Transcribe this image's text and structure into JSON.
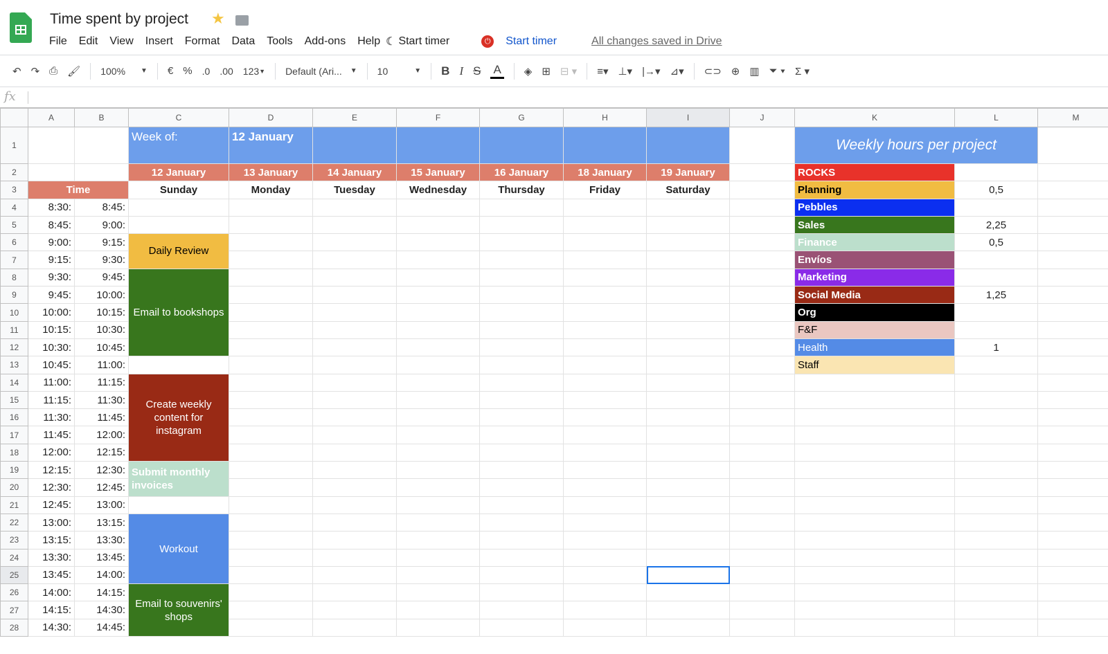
{
  "header": {
    "title": "Time spent by project",
    "menu": [
      "File",
      "Edit",
      "View",
      "Insert",
      "Format",
      "Data",
      "Tools",
      "Add-ons",
      "Help"
    ],
    "start_timer_1": "Start timer",
    "start_timer_2": "Start timer",
    "saved_status": "All changes saved in Drive"
  },
  "toolbar": {
    "zoom": "100%",
    "currency": "€",
    "percent": "%",
    "dec_less": ".0",
    "dec_more": ".00",
    "format_more": "123",
    "font": "Default (Ari...",
    "font_size": "10",
    "bold": "B",
    "italic": "I",
    "strike": "S",
    "text_color": "A",
    "fx": "fx"
  },
  "columns": [
    "A",
    "B",
    "C",
    "D",
    "E",
    "F",
    "G",
    "H",
    "I",
    "J",
    "K",
    "L",
    "M"
  ],
  "sheet": {
    "week_of_label": "Week of:",
    "week_of_value": "12 January",
    "time_label": "Time",
    "dates": [
      "12 January",
      "13 January",
      "14 January",
      "15 January",
      "16 January",
      "18 January",
      "19 January"
    ],
    "days": [
      "Sunday",
      "Monday",
      "Tuesday",
      "Wednesday",
      "Thursday",
      "Friday",
      "Saturday"
    ],
    "time_start": [
      "8:30:",
      "8:45:",
      "9:00:",
      "9:15:",
      "9:30:",
      "9:45:",
      "10:00:",
      "10:15:",
      "10:30:",
      "10:45:",
      "11:00:",
      "11:15:",
      "11:30:",
      "11:45:",
      "12:00:",
      "12:15:",
      "12:30:",
      "12:45:",
      "13:00:",
      "13:15:",
      "13:30:",
      "13:45:",
      "14:00:",
      "14:15:",
      "14:30:"
    ],
    "time_end": [
      "8:45:",
      "9:00:",
      "9:15:",
      "9:30:",
      "9:45:",
      "10:00:",
      "10:15:",
      "10:30:",
      "10:45:",
      "11:00:",
      "11:15:",
      "11:30:",
      "11:45:",
      "12:00:",
      "12:15:",
      "12:30:",
      "12:45:",
      "13:00:",
      "13:15:",
      "13:30:",
      "13:45:",
      "14:00:",
      "14:15:",
      "14:30:",
      "14:45:"
    ],
    "events": [
      {
        "label": "Daily Review",
        "color": "#f1bc42",
        "text": "#000"
      },
      {
        "label": "Email to bookshops",
        "color": "#38761d",
        "text": "#fff"
      },
      {
        "label": "Create weekly content for instagram",
        "color": "#992a15",
        "text": "#fff"
      },
      {
        "label": "Submit monthly invoices",
        "color": "#bcdfcc",
        "text": "#fff"
      },
      {
        "label": "Workout",
        "color": "#548be6",
        "text": "#fff"
      },
      {
        "label": "Email to souvenirs' shops",
        "color": "#38761d",
        "text": "#fff"
      }
    ]
  },
  "legend": {
    "title": "Weekly hours per project",
    "items": [
      {
        "name": "ROCKS",
        "color": "#e8322a",
        "text": "#fff",
        "hours": ""
      },
      {
        "name": "Planning",
        "color": "#f1bc42",
        "text": "#000",
        "hours": "0,5"
      },
      {
        "name": "Pebbles",
        "color": "#0b2ff0",
        "text": "#fff",
        "hours": ""
      },
      {
        "name": "Sales",
        "color": "#38761d",
        "text": "#fff",
        "hours": "2,25"
      },
      {
        "name": "Finance",
        "color": "#bcdfcc",
        "text": "#fff",
        "hours": "0,5"
      },
      {
        "name": "Envíos",
        "color": "#9a5275",
        "text": "#fff",
        "hours": ""
      },
      {
        "name": "Marketing",
        "color": "#8a2be8",
        "text": "#fff",
        "hours": ""
      },
      {
        "name": "Social Media",
        "color": "#992a15",
        "text": "#fff",
        "hours": "1,25"
      },
      {
        "name": "Org",
        "color": "#000000",
        "text": "#fff",
        "hours": ""
      },
      {
        "name": "F&F",
        "color": "#eac7c1",
        "text": "#000",
        "hours": ""
      },
      {
        "name": "Health",
        "color": "#548be6",
        "text": "#fff",
        "hours": "1"
      },
      {
        "name": "Staff",
        "color": "#fae5b2",
        "text": "#000",
        "hours": ""
      }
    ]
  }
}
